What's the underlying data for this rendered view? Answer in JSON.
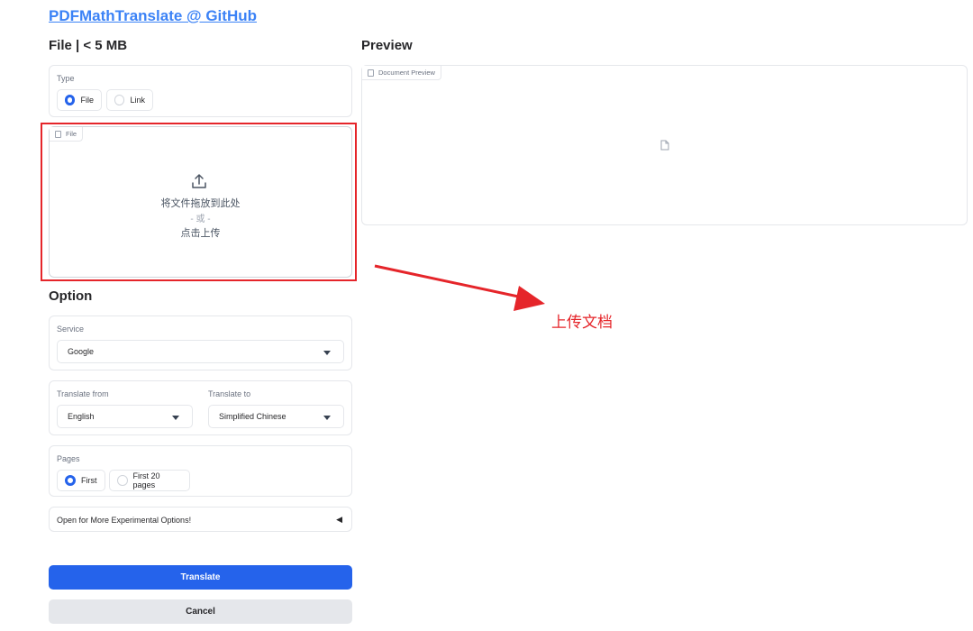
{
  "header": {
    "title": "PDFMathTranslate @ GitHub"
  },
  "file_section": {
    "heading": "File | < 5 MB",
    "type_label": "Type",
    "type_options": [
      "File",
      "Link"
    ],
    "type_selected": "File",
    "upload": {
      "tag": "File",
      "drop_text": "将文件拖放到此处",
      "or_text": "- 或 -",
      "click_text": "点击上传"
    }
  },
  "preview_section": {
    "heading": "Preview",
    "tag": "Document Preview"
  },
  "option_section": {
    "heading": "Option",
    "service_label": "Service",
    "service_value": "Google",
    "from_label": "Translate from",
    "from_value": "English",
    "to_label": "Translate to",
    "to_value": "Simplified Chinese",
    "pages_label": "Pages",
    "pages_options": [
      "First",
      "First 20 pages"
    ],
    "pages_selected": "First",
    "experimental_label": "Open for More Experimental Options!",
    "experimental_caret": "◀"
  },
  "actions": {
    "translate_label": "Translate",
    "cancel_label": "Cancel"
  },
  "annotation": {
    "text": "上传文档",
    "color": "#e5252a"
  },
  "colors": {
    "primary": "#2563eb",
    "link": "#3b82f6",
    "annotation": "#e5252a"
  }
}
